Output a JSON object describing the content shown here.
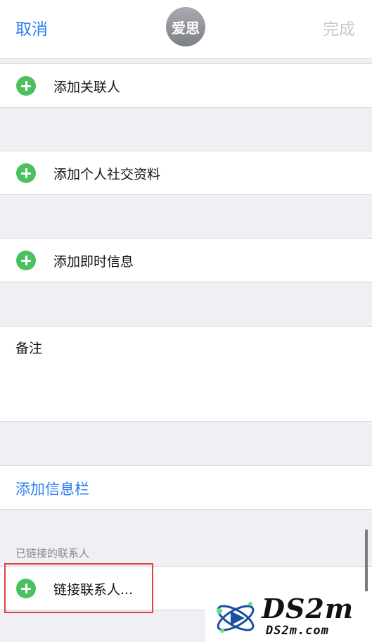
{
  "header": {
    "cancel_label": "取消",
    "avatar_text": "爱思",
    "done_label": "完成"
  },
  "rows": {
    "add_related": "添加关联人",
    "add_social": "添加个人社交资料",
    "add_im": "添加即时信息",
    "notes": "备注",
    "add_field": "添加信息栏"
  },
  "linked": {
    "section_header": "已链接的联系人",
    "link_contacts": "链接联系人..."
  },
  "watermark": {
    "big": "DS2m",
    "small": "DS2m.com"
  },
  "colors": {
    "accent_blue": "#2f7ef2",
    "add_green": "#4ac15e",
    "disabled_gray": "#c9c9cc",
    "highlight_red": "#e2433f"
  },
  "icons": {
    "add": "plus-circle-icon"
  }
}
